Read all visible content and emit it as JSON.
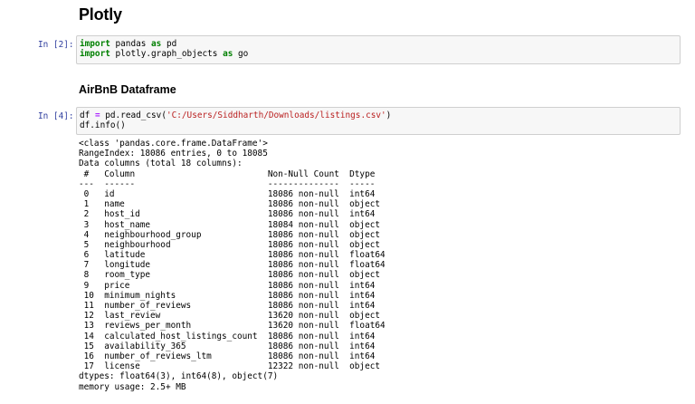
{
  "notebook": {
    "title": "Plotly",
    "section_heading": "AirBnB Dataframe"
  },
  "cells": [
    {
      "prompt": "In [2]:",
      "code": [
        {
          "kw1": "import",
          "t1": " pandas ",
          "kw2": "as",
          "t2": " pd"
        },
        {
          "kw1": "import",
          "t1": " plotly.graph_objects ",
          "kw2": "as",
          "t2": " go"
        }
      ]
    },
    {
      "prompt": "In [4]:",
      "line1": {
        "a": "df ",
        "eq": "=",
        "b": " pd.read_csv(",
        "str": "'C:/Users/Siddharth/Downloads/listings.csv'",
        "c": ")"
      },
      "line2": "df.info()"
    }
  ],
  "output": {
    "header": [
      "<class 'pandas.core.frame.DataFrame'>",
      "RangeIndex: 18086 entries, 0 to 18085",
      "Data columns (total 18 columns):",
      " #   Column                          Non-Null Count  Dtype  ",
      "---  ------                          --------------  -----  "
    ],
    "rows": [
      " 0   id                              18086 non-null  int64  ",
      " 1   name                            18086 non-null  object ",
      " 2   host_id                         18086 non-null  int64  ",
      " 3   host_name                       18084 non-null  object ",
      " 4   neighbourhood_group             18086 non-null  object ",
      " 5   neighbourhood                   18086 non-null  object ",
      " 6   latitude                        18086 non-null  float64",
      " 7   longitude                       18086 non-null  float64",
      " 8   room_type                       18086 non-null  object ",
      " 9   price                           18086 non-null  int64  ",
      " 10  minimum_nights                  18086 non-null  int64  ",
      " 11  number_of_reviews               18086 non-null  int64  ",
      " 12  last_review                     13620 non-null  object ",
      " 13  reviews_per_month               13620 non-null  float64",
      " 14  calculated_host_listings_count  18086 non-null  int64  ",
      " 15  availability_365                18086 non-null  int64  ",
      " 16  number_of_reviews_ltm           18086 non-null  int64  ",
      " 17  license                         12322 non-null  object "
    ],
    "footer": [
      "dtypes: float64(3), int64(8), object(7)",
      "memory usage: 2.5+ MB"
    ]
  }
}
